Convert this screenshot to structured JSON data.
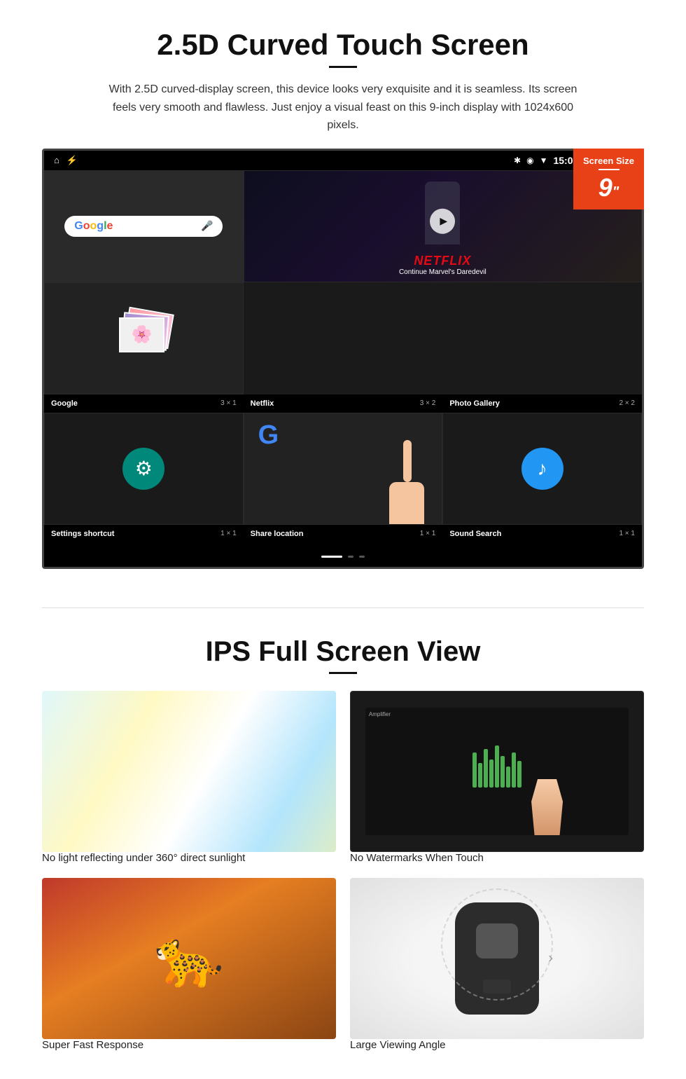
{
  "section1": {
    "title": "2.5D Curved Touch Screen",
    "description": "With 2.5D curved-display screen, this device looks very exquisite and it is seamless. Its screen feels very smooth and flawless. Just enjoy a visual feast on this 9-inch display with 1024x600 pixels.",
    "badge": {
      "label": "Screen Size",
      "size": "9",
      "unit": "\""
    },
    "statusbar": {
      "time": "15:06"
    },
    "apps": [
      {
        "name": "Google",
        "size": "3 × 1"
      },
      {
        "name": "Netflix",
        "size": "3 × 2"
      },
      {
        "name": "Photo Gallery",
        "size": "2 × 2"
      },
      {
        "name": "Settings shortcut",
        "size": "1 × 1"
      },
      {
        "name": "Share location",
        "size": "1 × 1"
      },
      {
        "name": "Sound Search",
        "size": "1 × 1"
      }
    ],
    "netflix": {
      "logo": "NETFLIX",
      "subtitle": "Continue Marvel's Daredevil"
    }
  },
  "section2": {
    "title": "IPS Full Screen View",
    "features": [
      {
        "label": "No light reflecting under 360° direct sunlight",
        "img_type": "sunlight"
      },
      {
        "label": "No Watermarks When Touch",
        "img_type": "amplifier"
      },
      {
        "label": "Super Fast Response",
        "img_type": "cheetah"
      },
      {
        "label": "Large Viewing Angle",
        "img_type": "car"
      }
    ]
  }
}
